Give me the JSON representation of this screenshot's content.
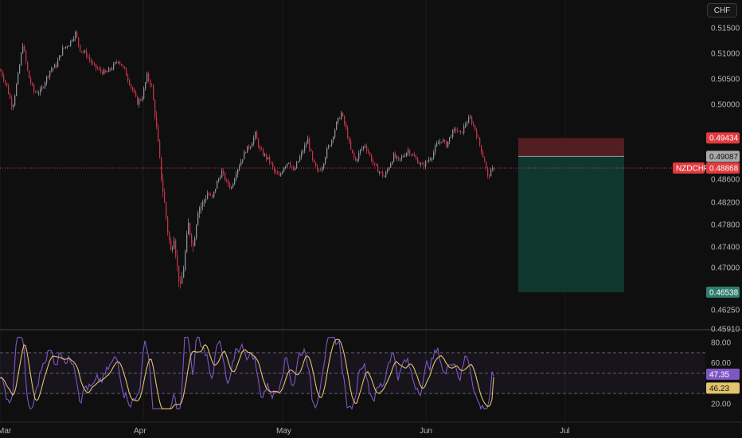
{
  "currency_button": "CHF",
  "colors": {
    "background": "#0f0f0f",
    "up": "#8a8f98",
    "down": "#c2334a",
    "rsi": "#7e57c2",
    "rsi_ma": "#e3c36b",
    "stop_zone": "#5a1f26",
    "target_zone": "#0f3b30",
    "symbol_badge": "#e03a3e",
    "target_badge": "#2f7d6f",
    "entry_badge": "#a9a9a9",
    "ma_badge": "#e3c36b"
  },
  "price_axis": {
    "ticks": [
      "0.51500",
      "0.51000",
      "0.50500",
      "0.50000",
      "0.48600",
      "0.48200",
      "0.47800",
      "0.47400",
      "0.47000",
      "0.46250",
      "0.45910"
    ]
  },
  "badges": {
    "stop": "0.49434",
    "entry": "0.49087",
    "symbol": "NZDCHF",
    "last": "0.48868",
    "target": "0.46538"
  },
  "rsi_axis": {
    "ticks": [
      "80.00",
      "60.00",
      "20.00"
    ],
    "rsi_value": "47.35",
    "ma_value": "46.23"
  },
  "time_axis": {
    "labels": [
      "Mar",
      "Apr",
      "May",
      "Jun",
      "Jul"
    ]
  },
  "chart_data": {
    "type": "candlestick",
    "title": "",
    "series_name": "NZDCHF",
    "x_start": "Mar",
    "ylim": [
      0.4591,
      0.5175
    ],
    "price_close_path": [
      [
        0,
        0.507
      ],
      [
        8,
        0.504
      ],
      [
        15,
        0.5
      ],
      [
        22,
        0.506
      ],
      [
        28,
        0.512
      ],
      [
        35,
        0.506
      ],
      [
        42,
        0.503
      ],
      [
        50,
        0.503
      ],
      [
        56,
        0.505
      ],
      [
        62,
        0.507
      ],
      [
        70,
        0.508
      ],
      [
        78,
        0.511
      ],
      [
        86,
        0.512
      ],
      [
        94,
        0.514
      ],
      [
        100,
        0.511
      ],
      [
        108,
        0.51
      ],
      [
        116,
        0.508
      ],
      [
        124,
        0.507
      ],
      [
        132,
        0.5065
      ],
      [
        140,
        0.5075
      ],
      [
        148,
        0.509
      ],
      [
        156,
        0.507
      ],
      [
        164,
        0.504
      ],
      [
        172,
        0.501
      ],
      [
        178,
        0.502
      ],
      [
        184,
        0.506
      ],
      [
        190,
        0.504
      ],
      [
        196,
        0.496
      ],
      [
        202,
        0.487
      ],
      [
        206,
        0.482
      ],
      [
        210,
        0.477
      ],
      [
        214,
        0.473
      ],
      [
        218,
        0.476
      ],
      [
        222,
        0.47
      ],
      [
        226,
        0.466
      ],
      [
        230,
        0.47
      ],
      [
        236,
        0.478
      ],
      [
        242,
        0.474
      ],
      [
        248,
        0.481
      ],
      [
        254,
        0.482
      ],
      [
        260,
        0.484
      ],
      [
        266,
        0.483
      ],
      [
        272,
        0.486
      ],
      [
        278,
        0.488
      ],
      [
        284,
        0.486
      ],
      [
        290,
        0.485
      ],
      [
        296,
        0.488
      ],
      [
        302,
        0.49
      ],
      [
        308,
        0.492
      ],
      [
        314,
        0.493
      ],
      [
        320,
        0.495
      ],
      [
        326,
        0.492
      ],
      [
        332,
        0.491
      ],
      [
        338,
        0.49
      ],
      [
        344,
        0.488
      ],
      [
        350,
        0.487
      ],
      [
        356,
        0.489
      ],
      [
        362,
        0.49
      ],
      [
        368,
        0.488
      ],
      [
        374,
        0.49
      ],
      [
        380,
        0.492
      ],
      [
        386,
        0.494
      ],
      [
        392,
        0.49
      ],
      [
        398,
        0.488
      ],
      [
        404,
        0.489
      ],
      [
        410,
        0.492
      ],
      [
        416,
        0.494
      ],
      [
        422,
        0.497
      ],
      [
        428,
        0.499
      ],
      [
        434,
        0.496
      ],
      [
        440,
        0.492
      ],
      [
        446,
        0.49
      ],
      [
        452,
        0.492
      ],
      [
        458,
        0.493
      ],
      [
        464,
        0.491
      ],
      [
        470,
        0.489
      ],
      [
        476,
        0.488
      ],
      [
        482,
        0.487
      ],
      [
        488,
        0.489
      ],
      [
        494,
        0.491
      ],
      [
        500,
        0.49
      ],
      [
        506,
        0.491
      ],
      [
        512,
        0.492
      ],
      [
        518,
        0.491
      ],
      [
        524,
        0.49
      ],
      [
        530,
        0.489
      ],
      [
        536,
        0.49
      ],
      [
        542,
        0.491
      ],
      [
        548,
        0.493
      ],
      [
        554,
        0.494
      ],
      [
        560,
        0.493
      ],
      [
        566,
        0.495
      ],
      [
        572,
        0.496
      ],
      [
        578,
        0.495
      ],
      [
        584,
        0.497
      ],
      [
        590,
        0.498
      ],
      [
        596,
        0.496
      ],
      [
        602,
        0.493
      ],
      [
        608,
        0.49
      ],
      [
        612,
        0.487
      ],
      [
        616,
        0.488
      ],
      [
        620,
        0.4887
      ]
    ],
    "position": {
      "stop": 0.49434,
      "entry": 0.49087,
      "target": 0.46538,
      "last": 0.48868
    },
    "rsi": {
      "ylim": [
        10,
        90
      ],
      "bands": [
        30,
        50,
        70
      ],
      "ticks": [
        80,
        60,
        20
      ],
      "current": 47.35,
      "ma_current": 46.23
    }
  }
}
